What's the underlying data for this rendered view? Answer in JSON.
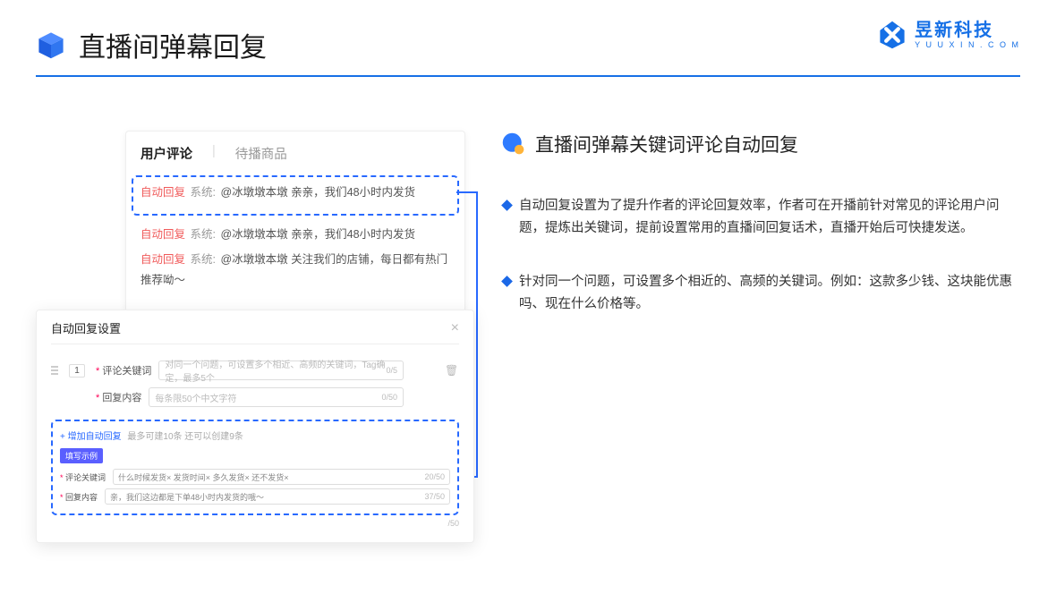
{
  "header": {
    "title": "直播间弹幕回复"
  },
  "logo": {
    "cn": "昱新科技",
    "en": "Y U U X I N . C O M"
  },
  "comments": {
    "tab_active": "用户评论",
    "tab_other": "待播商品",
    "items": [
      {
        "auto": "自动回复",
        "sys": "系统:",
        "text": "@冰墩墩本墩 亲亲，我们48小时内发货"
      },
      {
        "auto": "自动回复",
        "sys": "系统:",
        "text": "@冰墩墩本墩 亲亲，我们48小时内发货"
      },
      {
        "auto": "自动回复",
        "sys": "系统:",
        "text": "@冰墩墩本墩 关注我们的店铺，每日都有热门推荐呦～"
      }
    ]
  },
  "settings": {
    "title": "自动回复设置",
    "row1_num": "1",
    "row1_label": "评论关键词",
    "row1_placeholder": "对同一个问题，可设置多个相近、高频的关键词，Tag确定，最多5个",
    "row1_count": "0/5",
    "row2_label": "回复内容",
    "row2_placeholder": "每条限50个中文字符",
    "row2_count": "0/50",
    "add_text": "+ 增加自动回复",
    "add_hint": "最多可建10条 还可以创建9条",
    "example_badge": "填写示例",
    "ex_kw_label": "评论关键词",
    "ex_tags": "什么时候发货×   发货时间×   多久发货×   还不发货×",
    "ex_kw_count": "20/50",
    "ex_reply_label": "回复内容",
    "ex_reply_text": "亲，我们这边都是下单48小时内发货的哦～",
    "ex_reply_count": "37/50",
    "outer_count": "/50"
  },
  "right": {
    "title": "直播间弹幕关键词评论自动回复",
    "bullets": [
      "自动回复设置为了提升作者的评论回复效率，作者可在开播前针对常见的评论用户问题，提炼出关键词，提前设置常用的直播间回复话术，直播开始后可快捷发送。",
      "针对同一个问题，可设置多个相近的、高频的关键词。例如：这款多少钱、这块能优惠吗、现在什么价格等。"
    ]
  }
}
